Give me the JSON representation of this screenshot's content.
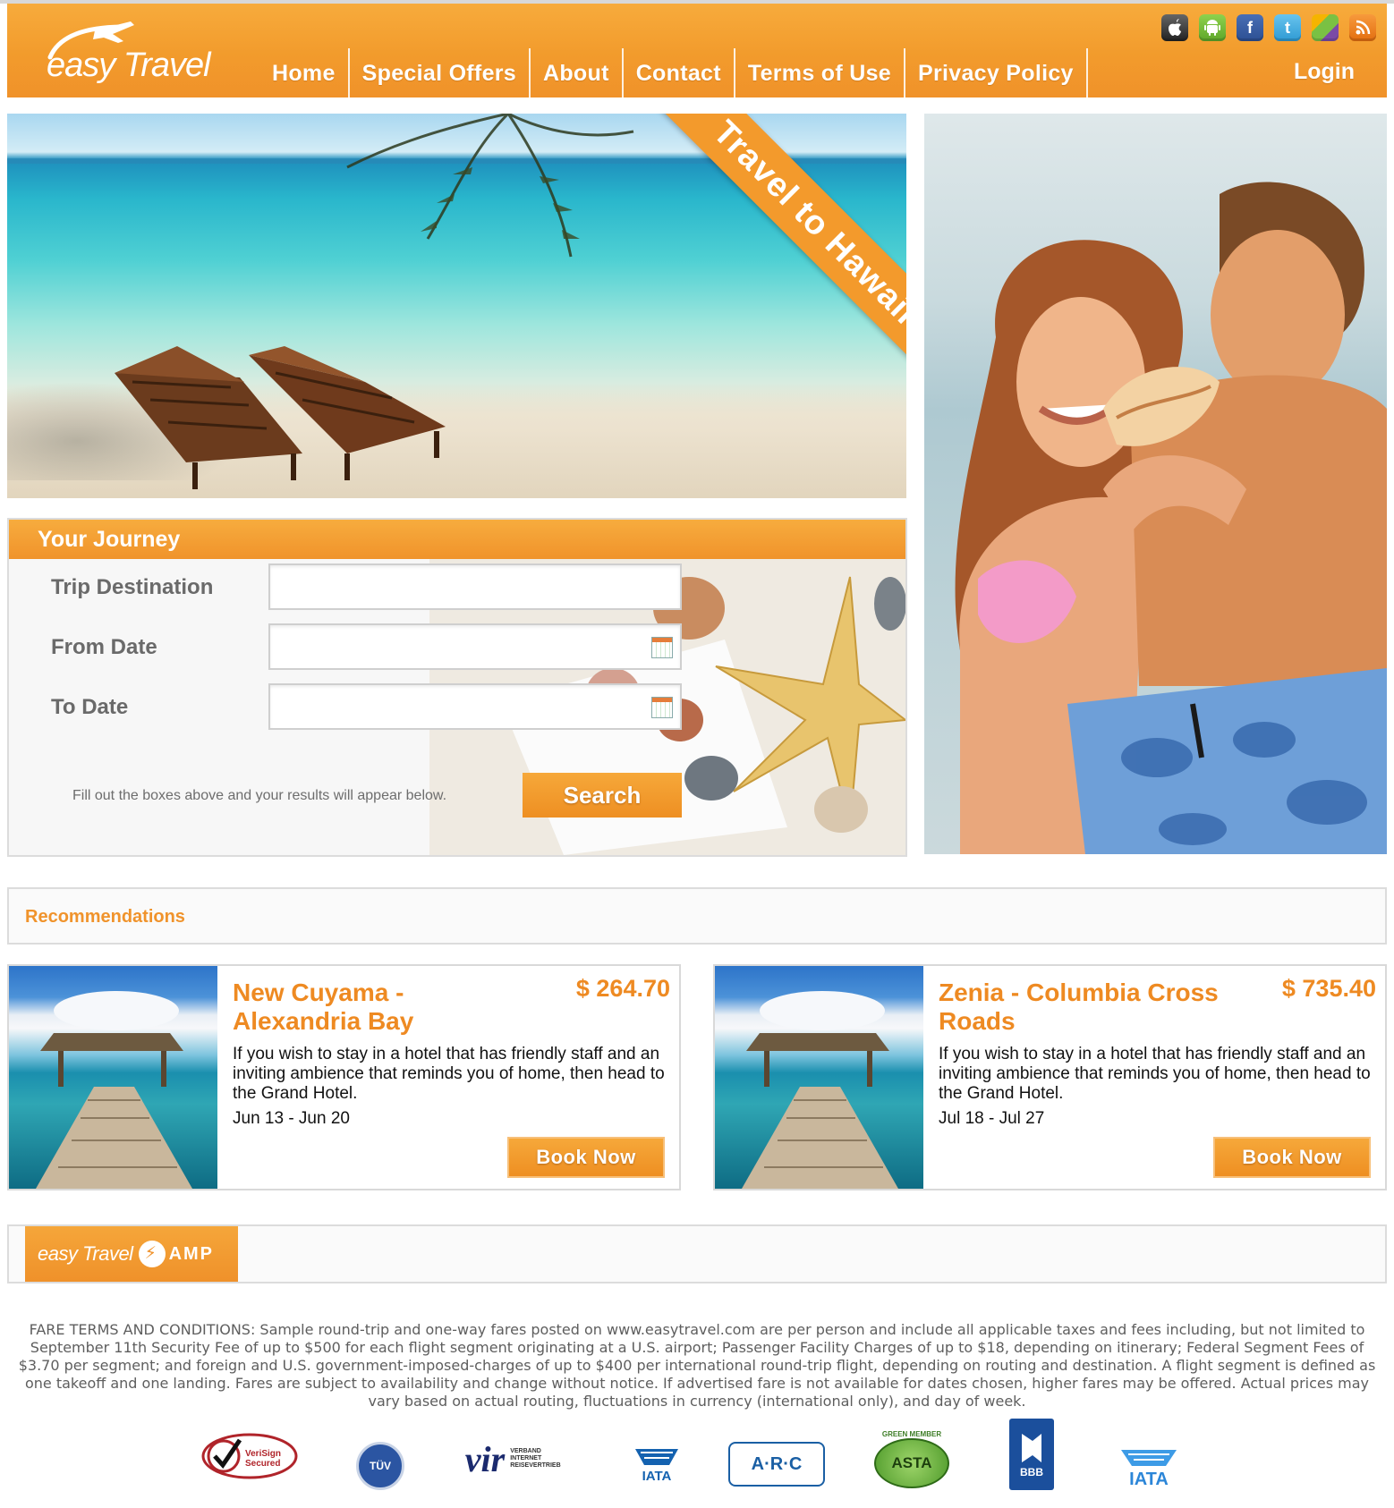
{
  "brand": {
    "word1": "easy",
    "word2": "Travel"
  },
  "nav": {
    "items": [
      "Home",
      "Special Offers",
      "About",
      "Contact",
      "Terms of Use",
      "Privacy Policy"
    ],
    "login": "Login"
  },
  "social_icons": [
    "apple-icon",
    "android-icon",
    "facebook-icon",
    "twitter-icon",
    "cube-icon",
    "rss-icon"
  ],
  "colors": {
    "accent": "#f29b2c",
    "text_gray": "#6a6a6a",
    "title_orange": "#ee8a22"
  },
  "hero": {
    "banner": "Travel to Hawaii"
  },
  "journey": {
    "title": "Your Journey",
    "fields": [
      {
        "label": "Trip Destination",
        "value": "",
        "placeholder": ""
      },
      {
        "label": "From Date",
        "value": "",
        "placeholder": ""
      },
      {
        "label": "To Date",
        "value": "",
        "placeholder": ""
      }
    ],
    "hint": "Fill out the boxes above and your results will appear below.",
    "search_label": "Search"
  },
  "recommendations": {
    "title": "Recommendations",
    "cards": [
      {
        "title": "New Cuyama - Alexandria Bay",
        "price": "$ 264.70",
        "description": "If you wish to stay in a hotel that has friendly staff and an inviting ambience that reminds you of home, then head to the Grand Hotel.",
        "dates": "Jun 13 - Jun 20",
        "book_label": "Book Now"
      },
      {
        "title": "Zenia - Columbia Cross Roads",
        "price": "$ 735.40",
        "description": "If you wish to stay in a hotel that has friendly staff and an inviting ambience that reminds you of home, then head to the Grand Hotel.",
        "dates": "Jul 18 - Jul 27",
        "book_label": "Book Now"
      }
    ]
  },
  "amp": {
    "brand1": "easy Travel",
    "brand2": "AMP"
  },
  "fare_terms": "FARE TERMS AND CONDITIONS: Sample round-trip and one-way fares posted on www.easytravel.com are per person and include all applicable taxes and fees including, but not limited to September 11th Security Fee of up to $500 for each flight segment originating at a U.S. airport; Passenger Facility Charges of up to $18, depending on itinerary; Federal Segment Fees of $3.70 per segment; and foreign and U.S. government-imposed-charges of up to $400 per international round-trip flight, depending on routing and destination. A flight segment is defined as one takeoff and one landing. Fares are subject to availability and change without notice. If advertised fare is not available for dates chosen, higher fares may be offered. Actual prices may vary based on actual routing, fluctuations in currency (international only), and day of week.",
  "badges": {
    "verisign": "VeriSign Secured",
    "tuv": "TÜV",
    "vir": "vir",
    "vir_sub": "VERBAND INTERNET REISEVERTRIEB",
    "iata1": "IATA",
    "arc": "A·R·C",
    "asta": "ASTA",
    "asta_sub": "GREEN MEMBER",
    "bbb": "BBB",
    "iata2": "IATA"
  }
}
